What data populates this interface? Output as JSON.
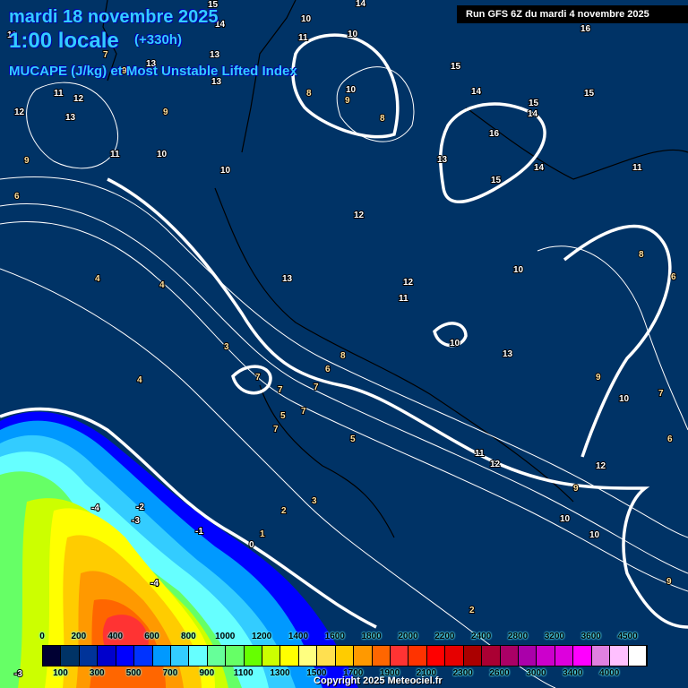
{
  "header": {
    "date": "mardi 18 novembre 2025",
    "time": "1:00 locale",
    "offset": "(+330h)",
    "parameter": "MUCAPE (J/kg) et Most Unstable Lifted Index",
    "run": "Run GFS 6Z du mardi 4 novembre 2025"
  },
  "legend": {
    "top_labels": [
      "0",
      "200",
      "400",
      "600",
      "800",
      "1000",
      "1200",
      "1400",
      "1600",
      "1800",
      "2000",
      "2200",
      "2400",
      "2800",
      "3200",
      "3600",
      "4500"
    ],
    "bottom_labels": [
      "100",
      "300",
      "500",
      "700",
      "900",
      "1100",
      "1300",
      "1500",
      "1700",
      "1900",
      "2100",
      "2300",
      "2600",
      "3000",
      "3400",
      "4000"
    ],
    "colors": [
      "#000033",
      "#003366",
      "#003399",
      "#0000cc",
      "#0000ff",
      "#0033ff",
      "#0099ff",
      "#33ccff",
      "#66ffff",
      "#66ff99",
      "#66ff66",
      "#66ff00",
      "#ccff00",
      "#ffff00",
      "#ffff80",
      "#ffe050",
      "#ffcc00",
      "#ff9900",
      "#ff6600",
      "#ff3333",
      "#ff3300",
      "#ff0000",
      "#e60000",
      "#aa0000",
      "#aa0033",
      "#aa0066",
      "#aa00aa",
      "#cc00cc",
      "#dd00dd",
      "#ff00ff",
      "#e080e0",
      "#ffc0ff",
      "#ffffff"
    ]
  },
  "contour_labels": [
    "15",
    "14",
    "10",
    "11",
    "10",
    "14",
    "16",
    "11",
    "7",
    "9",
    "13",
    "13",
    "12",
    "15",
    "14",
    "9",
    "11",
    "12",
    "10",
    "9",
    "8",
    "8",
    "13",
    "15",
    "16",
    "14",
    "15",
    "11",
    "13",
    "14",
    "6",
    "9",
    "11",
    "10",
    "10",
    "13",
    "15",
    "12",
    "4",
    "4",
    "3",
    "13",
    "12",
    "11",
    "10",
    "8",
    "10",
    "13",
    "6",
    "6",
    "8",
    "7",
    "7",
    "5",
    "7",
    "7",
    "4",
    "5",
    "7",
    "9",
    "10",
    "7",
    "9",
    "11",
    "12",
    "12",
    "10",
    "10",
    "9",
    "6",
    "2",
    "3",
    "1",
    "0",
    "-1",
    "-2",
    "-3",
    "-4",
    "-4",
    "2",
    "0",
    "-3"
  ],
  "copyright": "Copyright 2025 Meteociel.fr"
}
